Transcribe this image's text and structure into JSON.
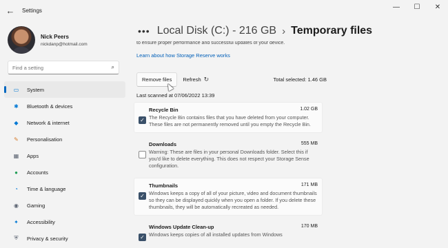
{
  "window": {
    "title": "Settings",
    "controls": {
      "minimize": "—",
      "maximize": "☐",
      "close": "✕"
    }
  },
  "profile": {
    "name": "Nick Peers",
    "email": "nickdanp@hotmail.com"
  },
  "search": {
    "placeholder": "Find a setting"
  },
  "sidebar": {
    "items": [
      {
        "label": "System",
        "icon": "monitor-icon",
        "glyph": "▭",
        "color": "#0078d4",
        "active": true
      },
      {
        "label": "Bluetooth & devices",
        "icon": "bluetooth-icon",
        "glyph": "✱",
        "color": "#0078d4"
      },
      {
        "label": "Network & internet",
        "icon": "wifi-icon",
        "glyph": "◆",
        "color": "#0078d4"
      },
      {
        "label": "Personalisation",
        "icon": "brush-icon",
        "glyph": "✎",
        "color": "#d67b2b"
      },
      {
        "label": "Apps",
        "icon": "apps-icon",
        "glyph": "▦",
        "color": "#5a6270"
      },
      {
        "label": "Accounts",
        "icon": "person-icon",
        "glyph": "●",
        "color": "#1f9d55"
      },
      {
        "label": "Time & language",
        "icon": "globe-clock-icon",
        "glyph": "◔",
        "color": "#0078d4"
      },
      {
        "label": "Gaming",
        "icon": "gamepad-icon",
        "glyph": "◉",
        "color": "#5a6270"
      },
      {
        "label": "Accessibility",
        "icon": "accessibility-icon",
        "glyph": "✦",
        "color": "#0078d4"
      },
      {
        "label": "Privacy & security",
        "icon": "shield-icon",
        "glyph": "⛨",
        "color": "#5a6270"
      }
    ]
  },
  "breadcrumb": {
    "more": "•••",
    "parent": "Local Disk (C:) - 216 GB",
    "separator": "›",
    "current": "Temporary files"
  },
  "intro_cut_text": "to ensure proper performance and successful updates of your device.",
  "learn_link": "Learn about how Storage Reserve works",
  "toolbar": {
    "remove_label": "Remove files",
    "refresh_label": "Refresh",
    "total_selected": "Total selected: 1.46 GB"
  },
  "last_scanned": "Last scanned at 07/06/2022 13:39",
  "items": [
    {
      "title": "Recycle Bin",
      "size": "1.02 GB",
      "checked": true,
      "description": "The Recycle Bin contains files that you have deleted from your computer. These files are not permanently removed until you empty the Recycle Bin."
    },
    {
      "title": "Downloads",
      "size": "555 MB",
      "checked": false,
      "description": "Warning: These are files in your personal Downloads folder. Select this if you'd like to delete everything. This does not respect your Storage Sense configuration."
    },
    {
      "title": "Thumbnails",
      "size": "171 MB",
      "checked": true,
      "description": "Windows keeps a copy of all of your picture, video and document thumbnails so they can be displayed quickly when you open a folder. If you delete these thumbnails, they will be automatically recreated as needed."
    },
    {
      "title": "Windows Update Clean-up",
      "size": "170 MB",
      "checked": true,
      "description": "Windows keeps copies of all installed updates from Windows"
    }
  ]
}
